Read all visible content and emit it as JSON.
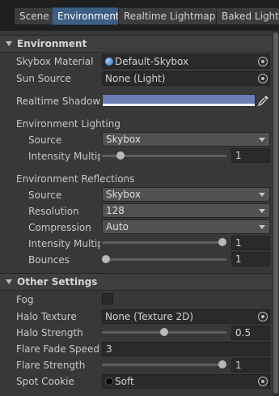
{
  "tabs": [
    {
      "label": "Scene",
      "active": false
    },
    {
      "label": "Environment",
      "active": true
    },
    {
      "label": "Realtime Lightmaps",
      "active": false
    },
    {
      "label": "Baked Lightmaps",
      "active": false
    }
  ],
  "environment": {
    "header": "Environment",
    "skybox_material": {
      "label": "Skybox Material",
      "value": "Default-Skybox"
    },
    "sun_source": {
      "label": "Sun Source",
      "value": "None (Light)"
    },
    "realtime_shadow_color": {
      "label": "Realtime Shadow Color",
      "color": "#6a7db4"
    },
    "lighting": {
      "header": "Environment Lighting",
      "source": {
        "label": "Source",
        "value": "Skybox"
      },
      "intensity": {
        "label": "Intensity Multiplier",
        "value": "1",
        "fraction": 0.125
      }
    },
    "reflections": {
      "header": "Environment Reflections",
      "source": {
        "label": "Source",
        "value": "Skybox"
      },
      "resolution": {
        "label": "Resolution",
        "value": "128"
      },
      "compression": {
        "label": "Compression",
        "value": "Auto"
      },
      "intensity": {
        "label": "Intensity Multiplier",
        "value": "1",
        "fraction": 1.0
      },
      "bounces": {
        "label": "Bounces",
        "value": "1",
        "fraction": 0.0
      }
    }
  },
  "other": {
    "header": "Other Settings",
    "fog": {
      "label": "Fog",
      "checked": false
    },
    "halo_texture": {
      "label": "Halo Texture",
      "value": "None (Texture 2D)"
    },
    "halo_strength": {
      "label": "Halo Strength",
      "value": "0.5",
      "fraction": 0.5
    },
    "flare_fade_speed": {
      "label": "Flare Fade Speed",
      "value": "3"
    },
    "flare_strength": {
      "label": "Flare Strength",
      "value": "1",
      "fraction": 1.0
    },
    "spot_cookie": {
      "label": "Spot Cookie",
      "value": "Soft"
    }
  },
  "icons": {
    "skybox": "skybox-material-icon",
    "picker": "object-picker-icon",
    "eyedropper": "eyedropper-icon",
    "cookie": "cookie-texture-icon"
  }
}
